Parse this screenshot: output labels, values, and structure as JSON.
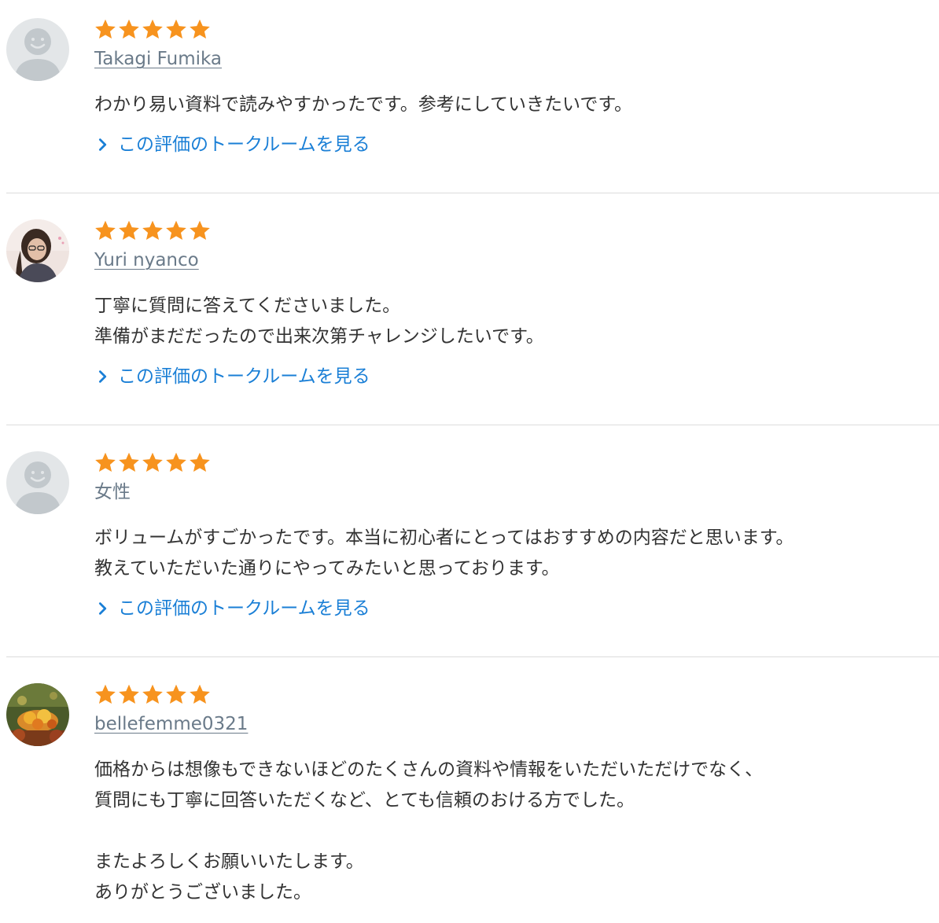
{
  "colors": {
    "star": "#f7931e",
    "link": "#1a7fd6",
    "username": "#6a7a89",
    "divider": "#dcdcdc"
  },
  "reviews": [
    {
      "rating": 5,
      "avatar_icon": "default-user-avatar-icon",
      "username": "Takagi Fumika",
      "comment": "わかり易い資料で読みやすかったです。参考にしていきたいです。",
      "talk_link": "この評価のトークルームを見る"
    },
    {
      "rating": 5,
      "avatar_icon": "user-photo-avatar",
      "username": "Yuri nyanco",
      "comment": "丁寧に質問に答えてくださいました。\n準備がまだだったので出来次第チャレンジしたいです。",
      "talk_link": "この評価のトークルームを見る"
    },
    {
      "rating": 5,
      "avatar_icon": "default-user-avatar-icon",
      "username": "女性",
      "comment": "ボリュームがすごかったです。本当に初心者にとってはおすすめの内容だと思います。\n教えていただいた通りにやってみたいと思っております。",
      "talk_link": "この評価のトークルームを見る"
    },
    {
      "rating": 5,
      "avatar_icon": "flower-photo-avatar",
      "username": "bellefemme0321",
      "comment": "価格からは想像もできないほどのたくさんの資料や情報をいただいただけでなく、\n質問にも丁寧に回答いただくなど、とても信頼のおける方でした。\n\nまたよろしくお願いいたします。\nありがとうございました。",
      "talk_link": ""
    }
  ]
}
